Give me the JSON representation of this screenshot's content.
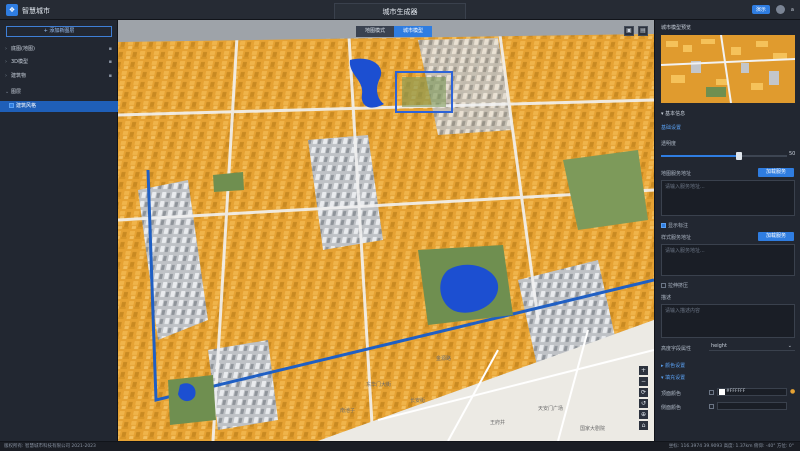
{
  "header": {
    "app_name": "智慧城市",
    "page_title": "城市生成器",
    "badge": "演示",
    "user": "a"
  },
  "left_panel": {
    "add_button": "+ 添加新图层",
    "layers": [
      {
        "label": "底图(地图)",
        "selected": false
      },
      {
        "label": "3D模型",
        "selected": false
      },
      {
        "label": "建筑物",
        "selected": false
      },
      {
        "label": "图层",
        "selected": false
      },
      {
        "label": "建筑风格",
        "selected": true
      }
    ]
  },
  "map": {
    "tabs": [
      "地图模式",
      "城市模型"
    ],
    "active_tab": 1,
    "tools": [
      "save-icon",
      "delete-icon"
    ],
    "controls": [
      "+",
      "−",
      "⟳",
      "↺",
      "⊕",
      "⌂"
    ],
    "labels": [
      "金源路",
      "东华门大街",
      "长安街",
      "南池子",
      "王府井",
      "天安门广场",
      "国家大剧院"
    ]
  },
  "right_panel": {
    "preview_title": "城市模型预览",
    "section_title": "基本信息",
    "subsection": "基础设置",
    "opacity_label": "透明度",
    "opacity_value": "50",
    "opacity_level": 0.62,
    "tileset_label": "地图服务地址",
    "tileset_button": "加载服务",
    "tileset_placeholder": "请输入服务地址...",
    "show_label_checkbox": "显示标注",
    "style_label": "样式服务地址",
    "style_button": "加载服务",
    "style_placeholder": "请输入服务地址...",
    "extrude_checkbox": "拉伸挤压",
    "desc_label": "描述",
    "desc_placeholder": "请输入描述内容",
    "height_field_label": "高度字段属性",
    "height_field_value": "height",
    "color_section": "颜色设置",
    "fill_section": "填充设置",
    "top_color_label": "顶面颜色",
    "top_color_value": "#FFFFFF",
    "side_color_label": "侧面颜色",
    "side_color_value": "#1A1E26",
    "accent": "#2f7de1"
  },
  "statusbar": {
    "left": "版权所有: 智慧城市科技有限公司 2021-2023",
    "right": "坐标: 116.3974 39.9093 高度: 1.37km 俯仰: -40° 方位: 0°"
  }
}
